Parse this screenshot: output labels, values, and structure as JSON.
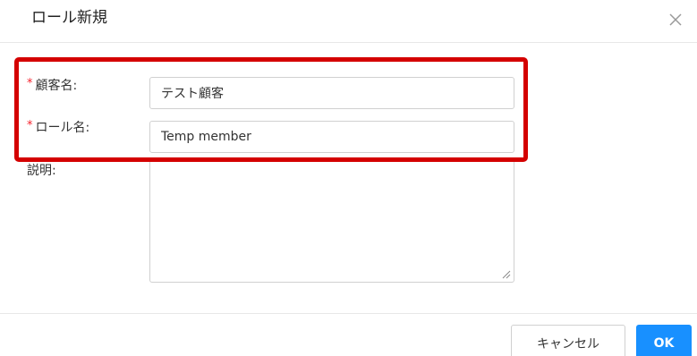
{
  "dialog": {
    "title": "ロール新規",
    "close_icon": "close-icon"
  },
  "form": {
    "customer": {
      "required_mark": "*",
      "label": "顧客名:",
      "value": "テスト顧客"
    },
    "role": {
      "required_mark": "*",
      "label": "ロール名:",
      "value": "Temp member"
    },
    "description": {
      "label": "説明:",
      "value": ""
    }
  },
  "footer": {
    "cancel_label": "キャンセル",
    "ok_label": "OK"
  },
  "colors": {
    "primary": "#1890ff",
    "required": "#f5222d",
    "highlight": "#d40000"
  }
}
